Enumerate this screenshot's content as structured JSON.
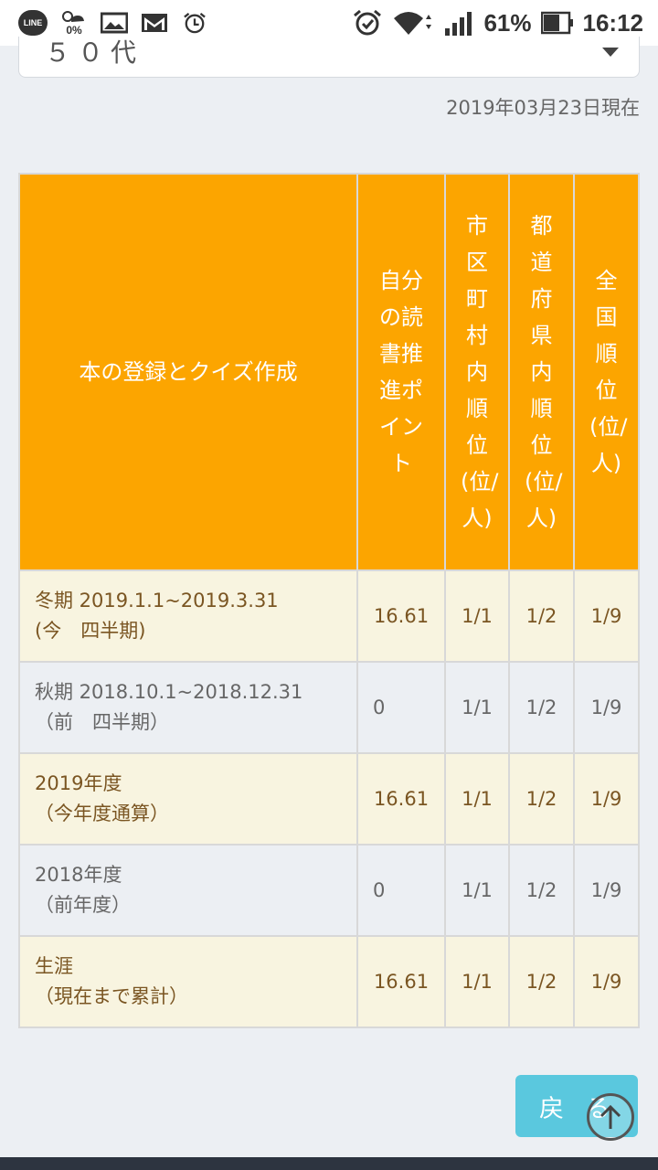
{
  "status_bar": {
    "app_icon": "LINE",
    "weather_pct": "0%",
    "battery_pct": "61%",
    "time": "16:12",
    "icons": [
      "line-icon",
      "weather-icon",
      "gallery-icon",
      "gmail-icon",
      "alarm-icon",
      "alarm-clock-icon",
      "wifi-icon",
      "signal-icon",
      "battery-icon"
    ]
  },
  "filter": {
    "age_value": "５０代"
  },
  "as_of": "2019年03月23日現在",
  "table": {
    "headers": {
      "category": "本の登録とクイズ作成",
      "points": "自分の読書推進ポイント",
      "city_rank": "市区町村内順位(位/人)",
      "pref_rank": "都道府県内順位(位/人)",
      "national_rank": "全国順位(位/人)"
    },
    "rows": [
      {
        "period": "冬期 2019.1.1~2019.3.31",
        "sub": "(今　四半期)",
        "points": "16.61",
        "city": "1/1",
        "pref": "1/2",
        "national": "1/9"
      },
      {
        "period": "秋期 2018.10.1~2018.12.31",
        "sub": "（前　四半期）",
        "points": "0",
        "city": "1/1",
        "pref": "1/2",
        "national": "1/9"
      },
      {
        "period": "2019年度",
        "sub": "（今年度通算）",
        "points": "16.61",
        "city": "1/1",
        "pref": "1/2",
        "national": "1/9"
      },
      {
        "period": "2018年度",
        "sub": "（前年度）",
        "points": "0",
        "city": "1/1",
        "pref": "1/2",
        "national": "1/9"
      },
      {
        "period": "生涯",
        "sub": "（現在まで累計）",
        "points": "16.61",
        "city": "1/1",
        "pref": "1/2",
        "national": "1/9"
      }
    ]
  },
  "back_button": "戻る",
  "colors": {
    "header_orange": "#fca500",
    "row_cream": "#f8f4e0",
    "row_gray": "#eceff3",
    "back_blue": "#5ac8de"
  }
}
